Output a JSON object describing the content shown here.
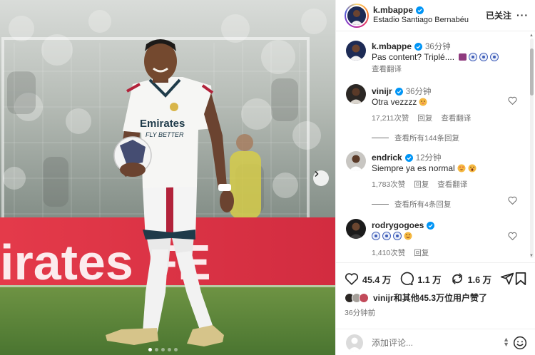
{
  "post": {
    "username": "k.mbappe",
    "location": "Estadio Santiago Bernabéu",
    "follow_label": "已关注",
    "more_label": "···",
    "caption": {
      "user": "k.mbappe",
      "time": "36分钟",
      "text": "Pas content? Triplé....",
      "emojis": [
        "tophat-icon",
        "ball-icon",
        "ball-icon",
        "ball-icon"
      ],
      "translate": "查看翻译"
    }
  },
  "photo": {
    "sponsor_text": "Emirates",
    "sponsor_sub": "FLY BETTER",
    "banner_text": "irates  FE",
    "slides_total": 5,
    "active_slide": 1
  },
  "comments": [
    {
      "user": "vinijr",
      "verified": true,
      "time": "36分钟",
      "text": "Otra vezzzz",
      "emojis": [
        "tongue-face-icon"
      ],
      "likes": "17,211次赞",
      "reply": "回复",
      "translate": "查看翻译",
      "view_replies": "查看所有144条回复"
    },
    {
      "user": "endrick",
      "verified": true,
      "time": "12分钟",
      "text": "Siempre ya es normal",
      "emojis": [
        "heart-eyes-icon",
        "surprised-face-icon"
      ],
      "likes": "1,783次赞",
      "reply": "回复",
      "translate": "查看翻译",
      "view_replies": "查看所有4条回复"
    },
    {
      "user": "rodrygogoes",
      "verified": true,
      "time": "",
      "text": "",
      "emojis": [
        "ball-icon",
        "ball-icon",
        "ball-icon",
        "smile-face-icon"
      ],
      "likes": "1,410次赞",
      "reply": "回复"
    }
  ],
  "actions": {
    "likes": "45.4 万",
    "comments": "1.1 万",
    "reposts": "1.6 万"
  },
  "liked_by": {
    "user": "vinijr",
    "text": "和其他45.3万位用户赞了"
  },
  "posted_ago": "36分钟前",
  "compose": {
    "placeholder": "添加评论..."
  },
  "colors": {
    "verified": "#0095f6",
    "secondary_text": "#737373",
    "kit_red": "#b2223a",
    "pitch_green": "#5e8a3a"
  }
}
